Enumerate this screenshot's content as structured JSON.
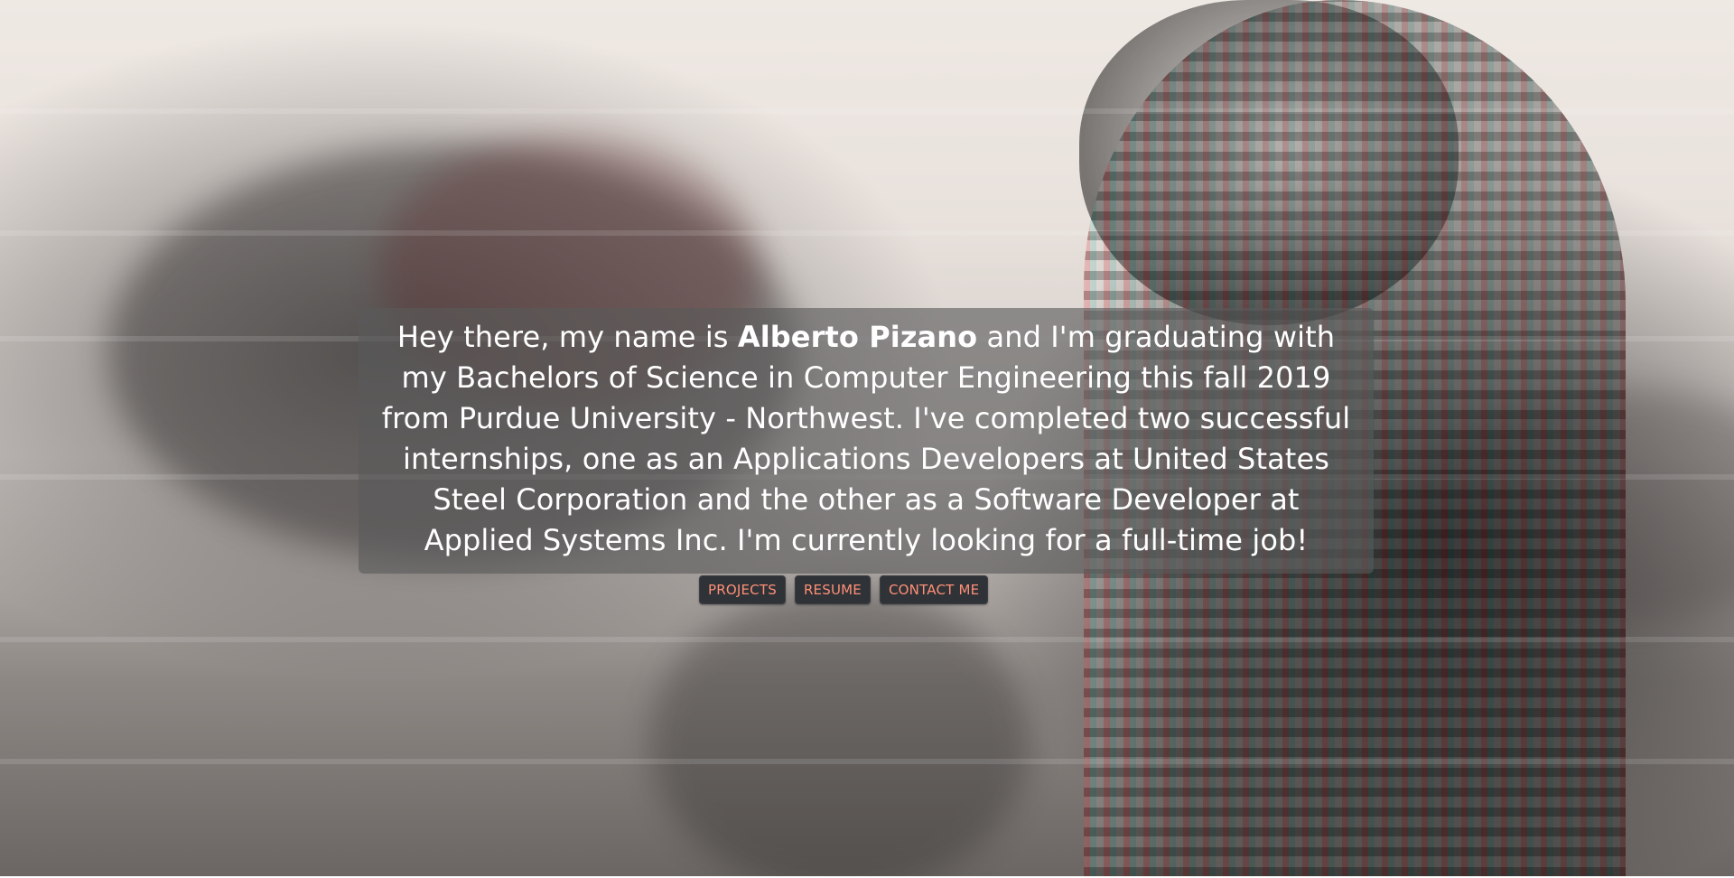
{
  "hero": {
    "intro": {
      "prefix": "Hey there, my name is ",
      "name": "Alberto Pizano",
      "suffix": " and I'm graduating with my Bachelors of Science in Computer Engineering this fall 2019 from Purdue University - Northwest. I've completed two successful internships, one as an Applications Developers at United States Steel Corporation and the other as a Software Developer at Applied Systems Inc. I'm currently looking for a full-time job!"
    },
    "buttons": [
      {
        "label": "PROJECTS"
      },
      {
        "label": "RESUME"
      },
      {
        "label": "CONTACT ME"
      }
    ]
  },
  "colors": {
    "card_bg": "#5a5a5a",
    "button_bg": "#2f3337",
    "button_text": "#ff8f77",
    "text": "#ffffff"
  }
}
